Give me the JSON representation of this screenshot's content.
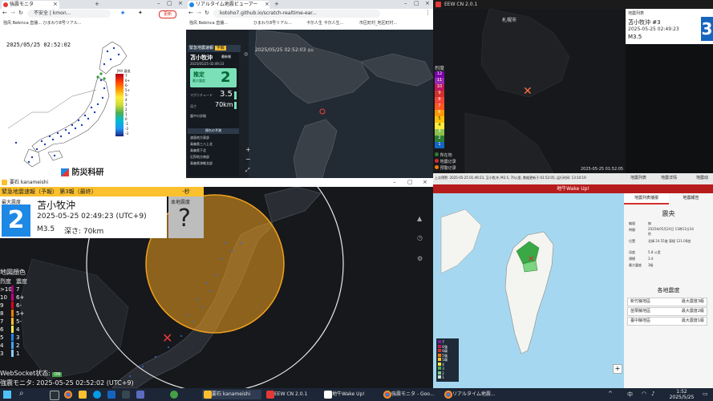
{
  "win_nied": {
    "tab_title": "強震モニタ",
    "tab2_title": "kmon...",
    "address": "不安全 | kmon...",
    "bookmarks": "強风 Bebinca 直播...  ひまわり8号リアル...",
    "timestamp": "2025/05/25 02:52:02",
    "logo_text": "防災科研",
    "scale_label": "JMA 震度",
    "scale_ticks": [
      "7",
      "6+",
      "6-",
      "5+",
      "5-",
      "4",
      "3",
      "2",
      "1",
      "0",
      "-1",
      "-2",
      "-3"
    ]
  },
  "win_realtime": {
    "tab_title": "リアルタイム地震ビューアー",
    "address": "kotoho7.github.io/scratch-realtime-ear...",
    "bookmarks": [
      "強风 Bebinca 直播...",
      "ひまわり8号リアル...",
      "卡尔人生 卡尔人生...",
      "市区町村_地区町村..."
    ],
    "panel_header": "緊急地震速報",
    "panel_tag": "予報",
    "panel_badge": "最新報",
    "region": "苫小牧沖",
    "origin_time": "2025/05/25 02:49:23",
    "estimate_label": "推定",
    "estimate_sub": "最大震度",
    "max_intensity": "2",
    "magnitude_label": "マグニチュード",
    "magnitude": "3.5",
    "depth_label": "深さ",
    "depth": "70km",
    "map_timestamp": "2025/05/25 02:52:03",
    "map_tag": "最新",
    "list_title": "震中の詳細",
    "list_header": "揺れの予測",
    "list_items": [
      "渡島地方東部",
      "青森県三八上北",
      "青森県下北",
      "石狩地方南部",
      "青森県津軽北部"
    ]
  },
  "win_eewcn": {
    "title": "EEW CN 2.0.1",
    "city_label": "札幌市",
    "legend_title": "烈度",
    "legend_values": [
      "12",
      "11",
      "10",
      "9",
      "8",
      "7",
      "6",
      "5",
      "4",
      "3",
      "2",
      "1"
    ],
    "legend_colors": [
      "#7b00a8",
      "#9c27b0",
      "#c2185b",
      "#d32f2f",
      "#f44336",
      "#ff5722",
      "#ff9800",
      "#ffc107",
      "#ffeb3b",
      "#8bc34a",
      "#2e7d32",
      "#1565c0"
    ],
    "key_items": [
      "所在地",
      "地震记录",
      "预警记录"
    ],
    "key_colors": [
      "#2e7d32",
      "#d32f2f",
      "#f57c00"
    ],
    "map_timestamp": "2025-05-25 01:52:05",
    "info_title": "地震列表",
    "info_region": "苫小牧沖 #3",
    "info_time": "2025-05-25 02:49:23",
    "info_mag": "M3.5",
    "info_intensity": "3",
    "bottom_text": "上次预警: 2025-05-25 01:49:23, 苫小牧沖, M3.5, 70公里, 数据更新于:01:52:05, 运行时间: 13:10:19",
    "buttons": [
      "地震列表",
      "地震详情",
      "地震动"
    ]
  },
  "win_kanameishi": {
    "title": "要石 kanameishi",
    "header": "緊急地震速報（予報） 第3報（最終）",
    "countdown": "-秒",
    "max_label": "最大震度",
    "max_intensity": "2",
    "region": "苫小牧沖",
    "origin_time": "2025-05-25 02:49:23 (UTC+9)",
    "magnitude": "M3.5",
    "depth": "深さ: 70km",
    "local_label": "本地震度",
    "local_intensity": "?",
    "legend_title": "地図顔色",
    "legend_head_a": "烈度",
    "legend_head_b": "震度",
    "legend_rows": [
      {
        "a": ">10",
        "b": "7",
        "color": "#a1007a"
      },
      {
        "a": "10",
        "b": "6+",
        "color": "#c2007f"
      },
      {
        "a": "9",
        "b": "6-",
        "color": "#e2001a"
      },
      {
        "a": "8",
        "b": "5+",
        "color": "#f57c00"
      },
      {
        "a": "7",
        "b": "5-",
        "color": "#fbc02d"
      },
      {
        "a": "6",
        "b": "4",
        "color": "#ffee58"
      },
      {
        "a": "5",
        "b": "3",
        "color": "#1e88e5"
      },
      {
        "a": "4",
        "b": "2",
        "color": "#42a5f5"
      },
      {
        "a": "3",
        "b": "1",
        "color": "#90caf9"
      }
    ],
    "websocket_label": "WebSocket状态:",
    "websocket_state": "ON",
    "footer": "強震モニタ: 2025-05-25 02:52:02 (UTC+9)"
  },
  "win_wakeup": {
    "title": "地牛Wake Up!",
    "tab_active": "地震列表播报",
    "tab_other": "地震報告",
    "detail_title": "震央",
    "detail_rows": [
      {
        "k": "編號",
        "v": "無"
      },
      {
        "k": "時間",
        "v": "2025年05月24日 13時11分34秒"
      },
      {
        "k": "位置",
        "v": "北緯 24.55度 東經 121.06度"
      },
      {
        "k": "深度",
        "v": "5.8 公里"
      },
      {
        "k": "規模",
        "v": "3.4"
      },
      {
        "k": "最大震度",
        "v": "3級"
      }
    ],
    "section_title": "各地震度",
    "areas": [
      {
        "name": "新竹縣地區",
        "level": "最大震度3級"
      },
      {
        "name": "苗栗縣地區",
        "level": "最大震度2級"
      },
      {
        "name": "臺中縣地區",
        "level": "最大震度1級"
      }
    ],
    "legend_labels": [
      "7",
      "6強",
      "6弱",
      "5強",
      "5弱",
      "4",
      "3",
      "2",
      "1"
    ]
  },
  "taskbar": {
    "items": [
      "要石 kanameishi",
      "EEW CN 2.0.1",
      "地牛Wake Up!",
      "強震モニタ - Goo...",
      "リアルタイム地震..."
    ],
    "time": "1:52",
    "date": "2025/5/25",
    "lang": "中"
  }
}
